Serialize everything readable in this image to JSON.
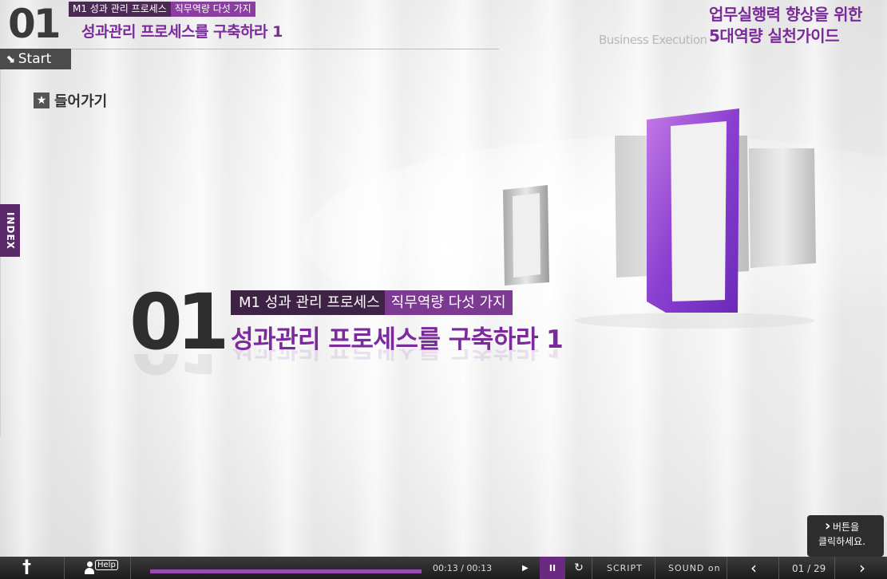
{
  "header": {
    "section_number": "01",
    "module_label": "M1 성과 관리 프로세스",
    "category_label": "직무역량 다섯 가지",
    "title": "성과관리 프로세스를 구축하라 1",
    "start_label": "Start"
  },
  "brand": {
    "subtitle_en": "Business Execution",
    "course_line1": "업무실행력 향상을 위한",
    "course_line2": "5대역량 실천가이드"
  },
  "enter_label": "들어가기",
  "index_tab": "INDEX",
  "hero": {
    "number": "01",
    "module_label": "M1 성과 관리 프로세스",
    "category_label": "직무역량 다섯 가지",
    "title": "성과관리 프로세스를 구축하라 1"
  },
  "tooltip": {
    "line1": "버튼을",
    "line2": "클릭하세요."
  },
  "controls": {
    "help_label": "Help",
    "time": "00:13 / 00:13",
    "progress": 1.0,
    "pause_label": "II",
    "script_label": "SCRIPT",
    "sound_label": "SOUND on",
    "page_indicator": "01 / 29"
  },
  "colors": {
    "accent_purple": "#7a2a9a",
    "chip_dark": "#4a2a52",
    "bar_bg": "#2a2a2a"
  }
}
